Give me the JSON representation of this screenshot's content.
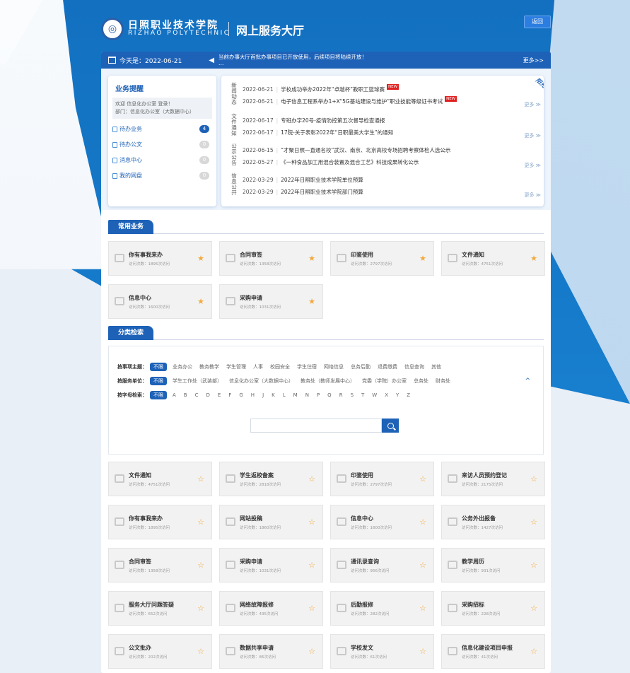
{
  "header": {
    "school_cn": "日照职业技术学院",
    "school_en": "RIZHAO POLYTECHNIC",
    "portal_title": "网上服务大厅",
    "back_label": "返回"
  },
  "notice_bar": {
    "today_label": "今天是：2022-06-21",
    "scroll_text_1": "当前办事大厅首批办事项目已开放使用，后续项目将陆续开放！",
    "scroll_text_2": "…",
    "more_label": "更多>>"
  },
  "reminders": {
    "title": "业务提醒",
    "welcome_line1": "欢迎 信息化办公室 登录！",
    "welcome_line2": "部门：信息化办公室（大数据中心）",
    "items": [
      {
        "label": "待办业务",
        "count": "4",
        "icon": "hourglass-icon",
        "active": true
      },
      {
        "label": "待办公文",
        "count": "0",
        "icon": "document-icon",
        "active": false
      },
      {
        "label": "消息中心",
        "count": "0",
        "icon": "message-icon",
        "active": false
      },
      {
        "label": "我的网盘",
        "count": "0",
        "icon": "cloud-icon",
        "active": false
      }
    ]
  },
  "news": {
    "ribbon": "阳光校务",
    "more_label": "更多 ≫",
    "new_badge": "NEW",
    "groups": [
      {
        "category": "新闻动态",
        "rows": [
          {
            "date": "2022-06-21",
            "title": "学校成功举办2022年“卓越杯”教职工篮球赛",
            "is_new": true
          },
          {
            "date": "2022-06-21",
            "title": "电子信息工程系举办1+X“5G基站建设与维护”职业技能等级证书考试",
            "is_new": true
          }
        ]
      },
      {
        "category": "文件通知",
        "rows": [
          {
            "date": "2022-06-17",
            "title": "专班办字20号-疫情防控第五次督导检查通报",
            "is_new": false
          },
          {
            "date": "2022-06-17",
            "title": "17院-关于表彰2022年“日职最美大学生”的通知",
            "is_new": false
          }
        ]
      },
      {
        "category": "公示公告",
        "rows": [
          {
            "date": "2022-06-15",
            "title": "“才聚日照—直通名校”武汉、南京、北京高校专场招聘考察体检人选公示",
            "is_new": false
          },
          {
            "date": "2022-05-27",
            "title": "《一种食品加工用混合装置及混合工艺》科技成果转化公示",
            "is_new": false
          }
        ]
      },
      {
        "category": "信息公开",
        "rows": [
          {
            "date": "2022-03-29",
            "title": "2022年日照职业技术学院单位预算",
            "is_new": false
          },
          {
            "date": "2022-03-29",
            "title": "2022年日照职业技术学院部门预算",
            "is_new": false
          }
        ]
      }
    ]
  },
  "common_services": {
    "title": "常用业务",
    "cards": [
      {
        "title": "你有事我来办",
        "visits": "访问次数：1895次访问",
        "icon": "eraser-icon",
        "starred": true
      },
      {
        "title": "合同审签",
        "visits": "访问次数：1358次访问",
        "icon": "handshake-icon",
        "starred": true
      },
      {
        "title": "印鉴使用",
        "visits": "访问次数：2797次访问",
        "icon": "seal-icon",
        "starred": true
      },
      {
        "title": "文件通知",
        "visits": "访问次数：4751次访问",
        "icon": "briefcase-icon",
        "starred": true
      },
      {
        "title": "信息中心",
        "visits": "访问次数：1600次访问",
        "icon": "screen-icon",
        "starred": true
      },
      {
        "title": "采购申请",
        "visits": "访问次数：1031次访问",
        "icon": "cart-icon",
        "starred": true
      }
    ]
  },
  "category_search": {
    "title": "分类检索",
    "row1_label": "按事项主题：",
    "row2_label": "按服务单位：",
    "row3_label": "按字母检索：",
    "all_label": "不限",
    "topics": [
      "业务办公",
      "教务教学",
      "学生管理",
      "人事",
      "校园安全",
      "学生住宿",
      "网络信息",
      "总务后勤",
      "退费缴费",
      "信息查询",
      "其他"
    ],
    "units": [
      "学生工作处（武装部）",
      "信息化办公室（大数据中心）",
      "教务处（教师发展中心）",
      "党委（学院）办公室",
      "总务处",
      "财务处"
    ],
    "letters": [
      "A",
      "B",
      "C",
      "D",
      "E",
      "F",
      "G",
      "H",
      "J",
      "K",
      "L",
      "M",
      "N",
      "P",
      "Q",
      "R",
      "S",
      "T",
      "W",
      "X",
      "Y",
      "Z"
    ],
    "collapse_glyph": "^",
    "search_placeholder": ""
  },
  "all_services": {
    "cards": [
      {
        "title": "文件通知",
        "visits": "访问次数：4751次访问",
        "icon": "briefcase-icon"
      },
      {
        "title": "学生返校备案",
        "visits": "访问次数：2818次访问",
        "icon": "list-icon"
      },
      {
        "title": "印鉴使用",
        "visits": "访问次数：2797次访问",
        "icon": "seal-icon"
      },
      {
        "title": "来访人员预约登记",
        "visits": "访问次数：2175次访问",
        "icon": "list-icon"
      },
      {
        "title": "你有事我来办",
        "visits": "访问次数：1895次访问",
        "icon": "eraser-icon"
      },
      {
        "title": "网站投稿",
        "visits": "访问次数：1860次访问",
        "icon": "handshake-icon"
      },
      {
        "title": "信息中心",
        "visits": "访问次数：1600次访问",
        "icon": "screen-icon"
      },
      {
        "title": "公务外出报备",
        "visits": "访问次数：1427次访问",
        "icon": "handshake-icon"
      },
      {
        "title": "合同审签",
        "visits": "访问次数：1358次访问",
        "icon": "handshake-icon"
      },
      {
        "title": "采购申请",
        "visits": "访问次数：1031次访问",
        "icon": "cart-icon"
      },
      {
        "title": "通讯录查询",
        "visits": "访问次数：956次访问",
        "icon": "book-icon"
      },
      {
        "title": "教学周历",
        "visits": "访问次数：931次访问",
        "icon": "calendar-icon"
      },
      {
        "title": "服务大厅问题答疑",
        "visits": "访问次数：652次访问",
        "icon": "trophy-icon"
      },
      {
        "title": "网络故障报修",
        "visits": "访问次数：435次访问",
        "icon": "tools-icon"
      },
      {
        "title": "后勤报修",
        "visits": "访问次数：282次访问",
        "icon": "tools-icon"
      },
      {
        "title": "采购招标",
        "visits": "访问次数：228次访问",
        "icon": "form-icon"
      },
      {
        "title": "公文批办",
        "visits": "访问次数：202次访问",
        "icon": "briefcase-icon"
      },
      {
        "title": "数据共享申请",
        "visits": "访问次数：86次访问",
        "icon": "share-icon"
      },
      {
        "title": "学校发文",
        "visits": "访问次数：61次访问",
        "icon": "file-icon"
      },
      {
        "title": "信息化建设项目申报",
        "visits": "访问次数：41次访问",
        "icon": "layers-icon"
      }
    ]
  },
  "colors": {
    "primary": "#1e62b8",
    "star": "#f2a93b",
    "new_badge": "#e02020"
  }
}
